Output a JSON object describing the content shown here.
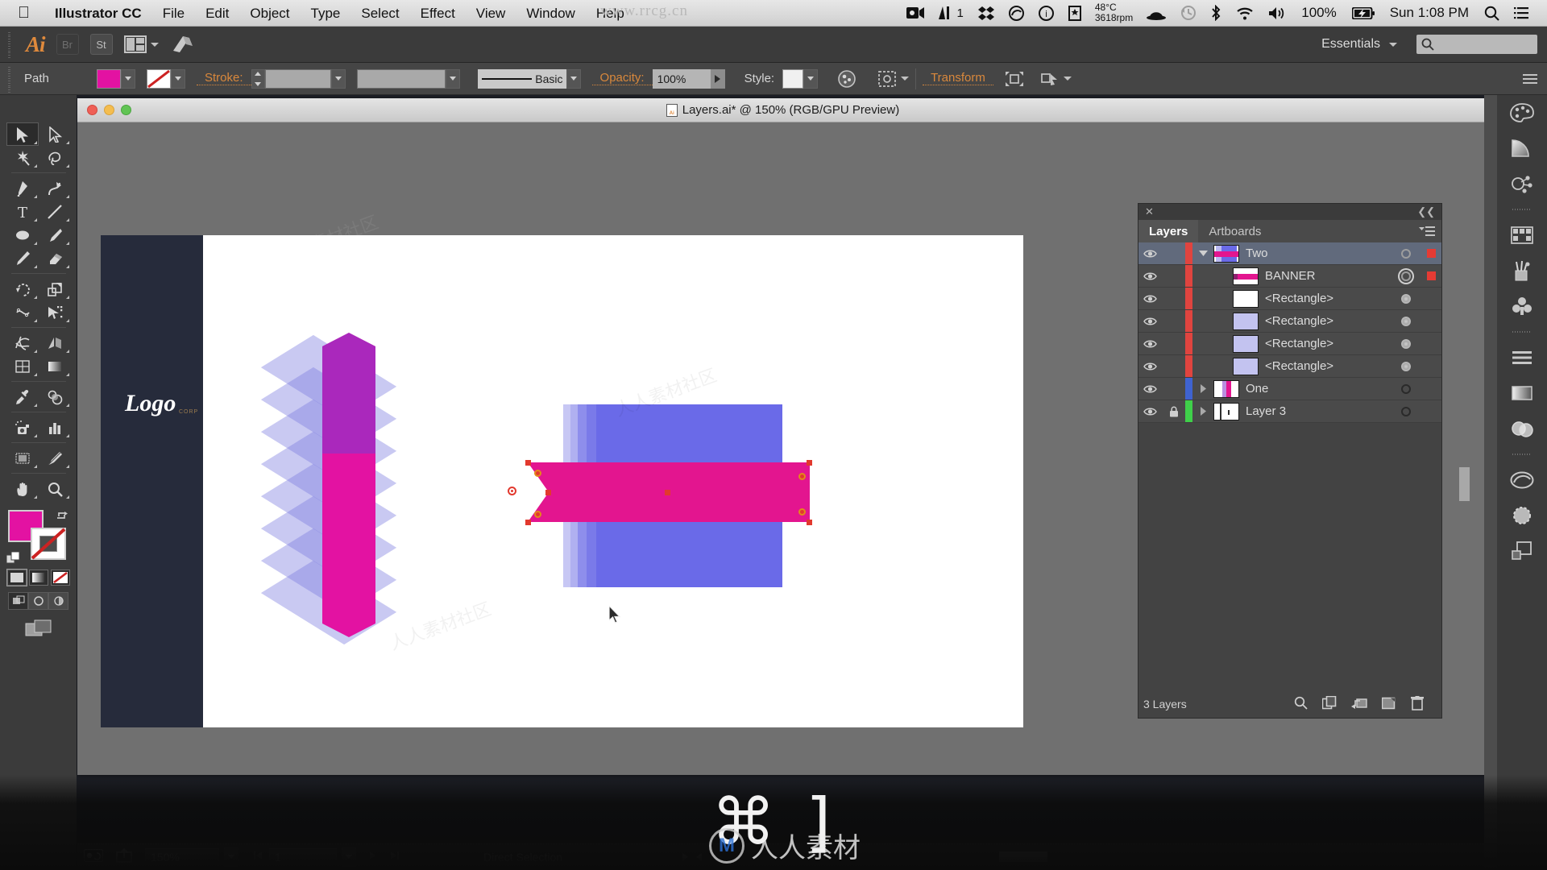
{
  "menubar": {
    "apple_icon": "apple-icon",
    "app_name": "Illustrator CC",
    "items": [
      "File",
      "Edit",
      "Object",
      "Type",
      "Select",
      "Effect",
      "View",
      "Window",
      "Help"
    ],
    "watermark": "www.rrcg.cn",
    "status": {
      "screen_recorder_icon": "screen-recorder-icon",
      "audio_meter_icon": "audio-meter-icon",
      "audio_meter_value": "1",
      "dropbox_icon": "dropbox-icon",
      "creative_cloud_icon": "creative-cloud-icon",
      "info_icon": "info-icon",
      "bookmark_icon": "bookmark-icon",
      "temperature": "48°C",
      "fan_speed": "3618rpm",
      "bowler_icon": "bowler-hat-icon",
      "timemachine_icon": "time-machine-icon",
      "bluetooth_icon": "bluetooth-icon",
      "wifi_icon": "wifi-icon",
      "volume_icon": "volume-icon",
      "battery_percent": "100%",
      "battery_icon": "battery-charging-icon",
      "clock": "Sun 1:08 PM",
      "spotlight_icon": "search-icon",
      "notification_icon": "notification-center-icon"
    }
  },
  "appbar": {
    "logo": "Ai",
    "bridge_label": "Br",
    "stock_label": "St",
    "arrange_icon": "arrange-documents-icon",
    "launch_icon": "launch-icon",
    "workspace": "Essentials",
    "search_icon": "search-icon",
    "search_placeholder": ""
  },
  "controlbar": {
    "object_label": "Path",
    "fill_color": "#e312a2",
    "stroke_color": "none",
    "stroke_label": "Stroke:",
    "stroke_weight": "",
    "stroke_profile": "Basic",
    "opacity_label": "Opacity:",
    "opacity_value": "100%",
    "style_label": "Style:",
    "recolor_icon": "recolor-artwork-icon",
    "select_similar_icon": "select-similar-icon",
    "transform_label": "Transform",
    "align_icon": "align-icon",
    "isolate_icon": "isolate-group-icon",
    "panel_menu_icon": "panel-menu-icon"
  },
  "toolbar": {
    "tools": [
      {
        "name": "selection-tool",
        "selected": true
      },
      {
        "name": "direct-selection-tool",
        "selected": false
      },
      {
        "name": "magic-wand-tool",
        "selected": false
      },
      {
        "name": "lasso-tool",
        "selected": false
      },
      {
        "name": "pen-tool",
        "selected": false
      },
      {
        "name": "curvature-tool",
        "selected": false
      },
      {
        "name": "type-tool",
        "selected": false
      },
      {
        "name": "line-segment-tool",
        "selected": false
      },
      {
        "name": "ellipse-tool",
        "selected": false
      },
      {
        "name": "paintbrush-tool",
        "selected": false
      },
      {
        "name": "pencil-tool",
        "selected": false
      },
      {
        "name": "eraser-tool",
        "selected": false
      },
      {
        "name": "rotate-tool",
        "selected": false
      },
      {
        "name": "scale-tool",
        "selected": false
      },
      {
        "name": "width-tool",
        "selected": false
      },
      {
        "name": "free-transform-tool",
        "selected": false
      },
      {
        "name": "shape-builder-tool",
        "selected": false
      },
      {
        "name": "perspective-grid-tool",
        "selected": false
      },
      {
        "name": "mesh-tool",
        "selected": false
      },
      {
        "name": "gradient-tool",
        "selected": false
      },
      {
        "name": "eyedropper-tool",
        "selected": false
      },
      {
        "name": "blend-tool",
        "selected": false
      },
      {
        "name": "symbol-sprayer-tool",
        "selected": false
      },
      {
        "name": "column-graph-tool",
        "selected": false
      },
      {
        "name": "artboard-tool",
        "selected": false
      },
      {
        "name": "slice-tool",
        "selected": false
      },
      {
        "name": "hand-tool",
        "selected": false
      },
      {
        "name": "zoom-tool",
        "selected": false
      }
    ],
    "fill_swatch": "#e312a2",
    "stroke_swatch": "none",
    "color_modes": [
      "color-fill",
      "gradient-fill",
      "none-fill"
    ],
    "draw_modes": [
      "draw-normal",
      "draw-behind",
      "draw-inside"
    ],
    "screen_mode": "change-screen-mode"
  },
  "document": {
    "title": "Layers.ai* @ 150% (RGB/GPU Preview)",
    "close_btn": "close-window",
    "minimize_btn": "minimize-window",
    "zoom_btn": "zoom-window"
  },
  "artwork": {
    "logo_text": "Logo",
    "logo_sub": "CORP",
    "navy_color": "#262b3b",
    "magenta_color": "#e312a2",
    "diamond_color": "rgba(126,126,225,0.42)",
    "blue_color": "#6a6ae8",
    "banner_color": "#e3158f"
  },
  "layers_panel": {
    "close_icon": "close-icon",
    "collapse_icon": "collapse-panel-icon",
    "tabs": [
      {
        "label": "Layers",
        "active": true
      },
      {
        "label": "Artboards",
        "active": false
      }
    ],
    "menu_icon": "panel-menu-icon",
    "rows": [
      {
        "name": "Two",
        "indent": 0,
        "color": "#e0443f",
        "selected": true,
        "expanded": true,
        "has_children": true,
        "locked": false,
        "target": "ring",
        "has_selection_square": true,
        "thumb": "banner-blue-thumb"
      },
      {
        "name": "BANNER",
        "indent": 1,
        "color": "#e0443f",
        "selected": false,
        "expanded": false,
        "has_children": false,
        "locked": false,
        "target": "double-ring",
        "has_selection_square": true,
        "thumb": "banner-magenta-thumb"
      },
      {
        "name": "<Rectangle>",
        "indent": 2,
        "color": "#e0443f",
        "selected": false,
        "expanded": false,
        "has_children": false,
        "locked": false,
        "target": "flat",
        "has_selection_square": false,
        "thumb": "white-rect-thumb"
      },
      {
        "name": "<Rectangle>",
        "indent": 2,
        "color": "#e0443f",
        "selected": false,
        "expanded": false,
        "has_children": false,
        "locked": false,
        "target": "flat",
        "has_selection_square": false,
        "thumb": "lavender-rect-thumb"
      },
      {
        "name": "<Rectangle>",
        "indent": 2,
        "color": "#e0443f",
        "selected": false,
        "expanded": false,
        "has_children": false,
        "locked": false,
        "target": "flat",
        "has_selection_square": false,
        "thumb": "lavender-rect-thumb"
      },
      {
        "name": "<Rectangle>",
        "indent": 2,
        "color": "#e0443f",
        "selected": false,
        "expanded": false,
        "has_children": false,
        "locked": false,
        "target": "flat",
        "has_selection_square": false,
        "thumb": "lavender-rect-thumb"
      },
      {
        "name": "One",
        "indent": 0,
        "color": "#3f63d0",
        "selected": false,
        "expanded": false,
        "has_children": true,
        "locked": false,
        "target": "dark",
        "has_selection_square": false,
        "thumb": "stripes-magenta-thumb"
      },
      {
        "name": "Layer 3",
        "indent": 0,
        "color": "#3fd04a",
        "selected": false,
        "expanded": false,
        "has_children": true,
        "locked": true,
        "target": "dark",
        "has_selection_square": false,
        "thumb": "white-stripes-thumb"
      }
    ],
    "footer_count": "3 Layers",
    "footer_icons": [
      "locate-object-icon",
      "duplicate-layer-icon",
      "make-sublayer-icon",
      "new-layer-icon",
      "delete-layer-icon"
    ]
  },
  "dock": {
    "icons": [
      "color-panel-icon",
      "color-guide-icon",
      "symbols-panel-icon",
      "swatches-panel-icon",
      "brushes-panel-icon",
      "graphic-styles-icon",
      "align-panel-icon",
      "gradient-panel-icon",
      "transparency-panel-icon",
      "libraries-panel-icon",
      "appearance-panel-icon",
      "artboards-panel-icon"
    ]
  },
  "statusbar": {
    "screen_icon": "presentation-mode-icon",
    "share_icon": "share-icon",
    "zoom_value": "150%",
    "artboard_value": "1",
    "tool_name": "Direct Selection",
    "prev_artboard_icon": "prev-artboard-icon",
    "next_artboard_icon": "next-artboard-icon"
  },
  "keystroke_overlay": {
    "glyph": "⌘ ]",
    "site_initial": "M",
    "site_text": "人人素材"
  },
  "watermarks": [
    "人人素材社区",
    "人人素材社区",
    "人人素材社区"
  ]
}
